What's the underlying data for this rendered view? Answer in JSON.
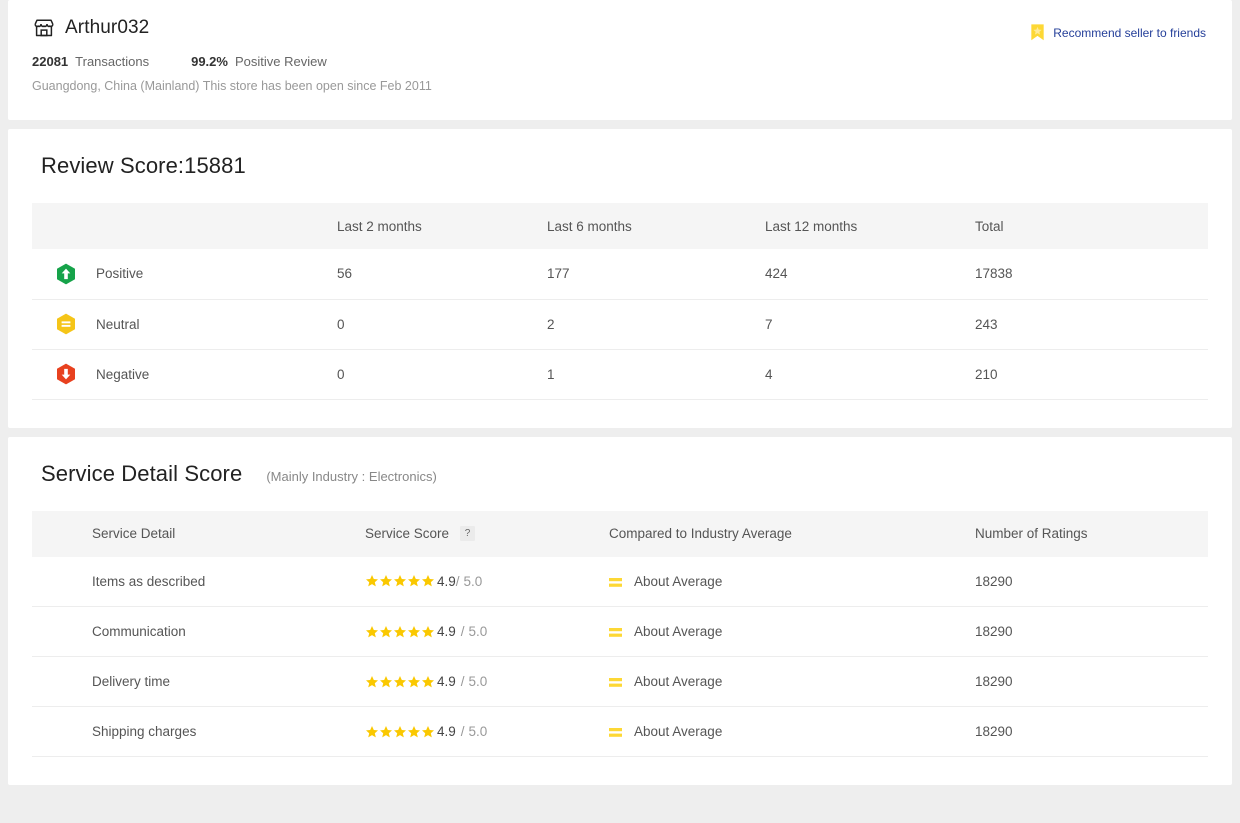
{
  "seller": {
    "store_icon": "storefront-icon",
    "name": "Arthur032",
    "transactions_value": "22081",
    "transactions_label": "Transactions",
    "positive_value": "99.2%",
    "positive_label": "Positive Review",
    "location_line": "Guangdong, China (Mainland) This store has been open since Feb 2011",
    "recommend": {
      "icon": "bookmark-star-icon",
      "label": "Recommend seller to friends",
      "link_color": "#26409a"
    }
  },
  "review_section": {
    "title": "Review Score:15881",
    "columns": [
      "",
      "Last 2 months",
      "Last 6 months",
      "Last 12 months",
      "Total"
    ],
    "rows": [
      {
        "icon": "hex-arrow-up-icon",
        "icon_color": "#27a94d",
        "label": "Positive",
        "last_2_months": "56",
        "last_6_months": "177",
        "last_12_months": "424",
        "total": "17838"
      },
      {
        "icon": "hex-equals-icon",
        "icon_color": "#f5c518",
        "label": "Neutral",
        "last_2_months": "0",
        "last_6_months": "2",
        "last_12_months": "7",
        "total": "243"
      },
      {
        "icon": "hex-arrow-down-icon",
        "icon_color": "#e8411f",
        "label": "Negative",
        "last_2_months": "0",
        "last_6_months": "1",
        "last_12_months": "4",
        "total": "210"
      }
    ]
  },
  "service_section": {
    "title": "Service Detail Score",
    "subtitle": "(Mainly Industry : Electronics)",
    "columns": {
      "detail": "Service Detail",
      "score": "Service Score",
      "help": "?",
      "compared": "Compared to Industry Average",
      "ratings": "Number of Ratings"
    },
    "rows": [
      {
        "detail": "Items as described",
        "stars": 5,
        "score": "4.9",
        "separator": "/",
        "max": "5.0",
        "tight": true,
        "compare_icon": "equals-icon",
        "compare": "About Average",
        "ratings": "18290"
      },
      {
        "detail": "Communication",
        "stars": 5,
        "score": "4.9",
        "separator": "/",
        "max": "5.0",
        "tight": false,
        "compare_icon": "equals-icon",
        "compare": "About Average",
        "ratings": "18290"
      },
      {
        "detail": "Delivery time",
        "stars": 5,
        "score": "4.9",
        "separator": "/",
        "max": "5.0",
        "tight": false,
        "compare_icon": "equals-icon",
        "compare": "About Average",
        "ratings": "18290"
      },
      {
        "detail": "Shipping charges",
        "stars": 5,
        "score": "4.9",
        "separator": "/",
        "max": "5.0",
        "tight": false,
        "compare_icon": "equals-icon",
        "compare": "About Average",
        "ratings": "18290"
      }
    ]
  },
  "colors": {
    "page_bg": "#eeeeee",
    "panel_bg": "#ffffff",
    "star": "#fac800",
    "header_row": "#f5f5f5"
  }
}
